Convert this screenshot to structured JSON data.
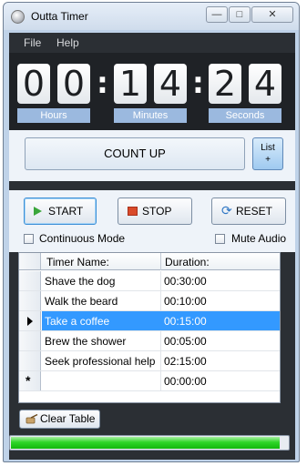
{
  "window": {
    "title": "Outta Timer",
    "controls": {
      "minimize": "—",
      "maximize": "□",
      "close": "✕"
    }
  },
  "menu": {
    "items": [
      "File",
      "Help"
    ]
  },
  "timer": {
    "digits": [
      "0",
      "0",
      "1",
      "4",
      "2",
      "4"
    ],
    "separator": ":",
    "labels": {
      "hours": "Hours",
      "minutes": "Minutes",
      "seconds": "Seconds"
    }
  },
  "mode": {
    "text": "COUNT UP",
    "list_button": "List\n+"
  },
  "controls": {
    "start": "START",
    "stop": "STOP",
    "reset": "RESET"
  },
  "options": {
    "continuous_mode": "Continuous Mode",
    "continuous_checked": false,
    "mute_audio": "Mute Audio",
    "mute_checked": false
  },
  "table": {
    "headers": {
      "name": "Timer Name:",
      "duration": "Duration:"
    },
    "rows": [
      {
        "name": "Shave the dog",
        "duration": "00:30:00"
      },
      {
        "name": "Walk the beard",
        "duration": "00:10:00"
      },
      {
        "name": "Take a coffee",
        "duration": "00:15:00"
      },
      {
        "name": "Brew the shower",
        "duration": "00:05:00"
      },
      {
        "name": "Seek professional help",
        "duration": "02:15:00"
      },
      {
        "name": "",
        "duration": "00:00:00"
      }
    ],
    "selected_row_index": 2,
    "new_row_marker": "*"
  },
  "clear_button": "Clear Table",
  "progress": {
    "fraction": 0.97,
    "color": "#2fd628"
  },
  "colors": {
    "dark_frame": "#2b2f34",
    "label_blue": "#9bb9df",
    "selection": "#3399ff"
  },
  "icons": {
    "start": "play-icon",
    "stop": "stop-icon",
    "reset": "refresh-icon",
    "clear": "broom-icon",
    "app": "app-icon"
  }
}
